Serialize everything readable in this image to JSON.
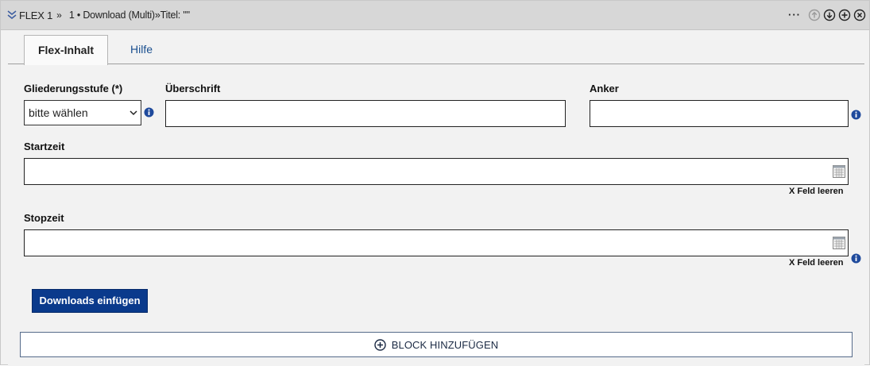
{
  "header": {
    "breadcrumb_main": "FLEX 1",
    "breadcrumb_sep": "»",
    "breadcrumb_detail": "1 • Download (Multi)»Titel: \"\"",
    "more_label": "···"
  },
  "tabs": [
    {
      "label": "Flex-Inhalt",
      "active": true
    },
    {
      "label": "Hilfe",
      "active": false
    }
  ],
  "fields": {
    "gliederung_label": "Gliederungsstufe (*)",
    "gliederung_value": "bitte wählen",
    "ueberschrift_label": "Überschrift",
    "ueberschrift_value": "",
    "anker_label": "Anker",
    "anker_value": "",
    "startzeit_label": "Startzeit",
    "startzeit_value": "",
    "stopzeit_label": "Stopzeit",
    "stopzeit_value": "",
    "clear_label": "X Feld leeren"
  },
  "buttons": {
    "downloads": "Downloads einfügen",
    "add_block": "BLOCK HINZUFÜGEN"
  },
  "colors": {
    "accent_blue": "#0a3a8c",
    "link_blue": "#1a4f8f",
    "info_blue": "#1f4a9c"
  },
  "icons": [
    "collapse-icon",
    "more-icon",
    "move-up-icon",
    "move-down-icon",
    "add-icon",
    "close-icon",
    "info-icon",
    "calendar-icon",
    "plus-circle-icon"
  ]
}
